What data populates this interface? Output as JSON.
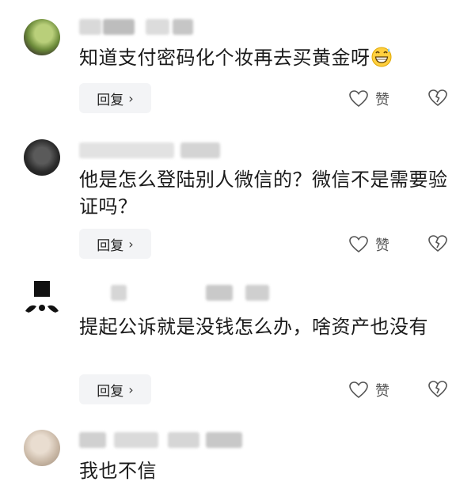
{
  "comments": [
    {
      "meta_text": "",
      "text": "知道支付密码化个妆再去买黄金呀",
      "emoji": "grinning-sweat-emoji",
      "reply_label": "回复",
      "like_label": "赞"
    },
    {
      "meta_text": "",
      "text": "他是怎么登陆别人微信的？微信不是需要验证吗？",
      "reply_label": "回复",
      "like_label": "赞"
    },
    {
      "meta_text": "",
      "text": "提起公诉就是没钱怎么办，啥资产也没有",
      "reply_label": "回复",
      "like_label": "赞"
    },
    {
      "meta_text": "",
      "text": "我也不信"
    }
  ],
  "icons": {
    "chevron": "chevron-right-icon",
    "like": "heart-outline-icon",
    "dislike": "broken-heart-icon"
  },
  "colors": {
    "button_bg": "#f3f4f6",
    "icon_stroke": "#555555",
    "meta_gray": "#9a9a9a"
  }
}
